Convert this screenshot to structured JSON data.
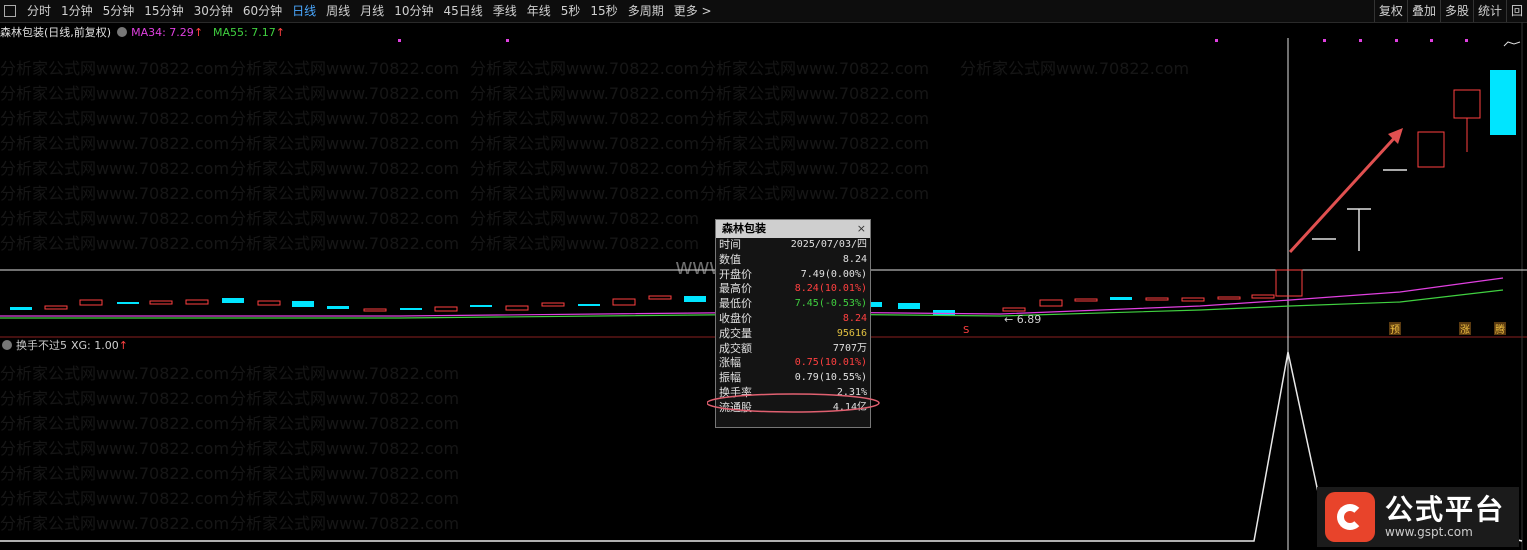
{
  "toolbar": {
    "periods": [
      "分时",
      "1分钟",
      "5分钟",
      "15分钟",
      "30分钟",
      "60分钟",
      "日线",
      "周线",
      "月线",
      "10分钟",
      "45日线",
      "季线",
      "年线",
      "5秒",
      "15秒",
      "多周期",
      "更多 >"
    ],
    "active": "日线",
    "right_buttons": [
      "复权",
      "叠加",
      "多股",
      "统计",
      "回"
    ]
  },
  "main": {
    "title": "森林包装(日线,前复权)",
    "ma34_label": "MA34: 7.29",
    "ma55_label": "MA55: 7.17",
    "up_arrow": "↑",
    "low_marker": "← 6.89",
    "signal_s": "S",
    "tags": [
      "预",
      "涨",
      "腾"
    ]
  },
  "sub": {
    "title": "换手不过5",
    "xg_label": "XG: 1.00",
    "up_arrow": "↑"
  },
  "tooltip": {
    "header": "森林包装",
    "close": "×",
    "rows": [
      {
        "label": "时间",
        "value": "2025/07/03/四",
        "color": "white"
      },
      {
        "label": "数值",
        "value": "8.24",
        "color": "white"
      },
      {
        "label": "开盘价",
        "value": "7.49(0.00%)",
        "color": "white"
      },
      {
        "label": "最高价",
        "value": "8.24(10.01%)",
        "color": "red"
      },
      {
        "label": "最低价",
        "value": "7.45(-0.53%)",
        "color": "green"
      },
      {
        "label": "收盘价",
        "value": "8.24",
        "color": "red"
      },
      {
        "label": "成交量",
        "value": "95616",
        "color": "yellow"
      },
      {
        "label": "成交额",
        "value": "7707万",
        "color": "white"
      },
      {
        "label": "涨幅",
        "value": "0.75(10.01%)",
        "color": "red"
      },
      {
        "label": "振幅",
        "value": "0.79(10.55%)",
        "color": "white"
      },
      {
        "label": "换手率",
        "value": "2.31%",
        "color": "white"
      },
      {
        "label": "流通股",
        "value": "4.14亿",
        "color": "white"
      }
    ]
  },
  "watermark": {
    "center": "www.gspt.com",
    "repeat": "分析家公式网www.70822.com"
  },
  "logo": {
    "title": "公式平台",
    "url": "www.gspt.com"
  },
  "colors": {
    "up": "#ff4040",
    "down": "#00e5ff",
    "ma34": "#e040e0",
    "ma55": "#40d040"
  }
}
